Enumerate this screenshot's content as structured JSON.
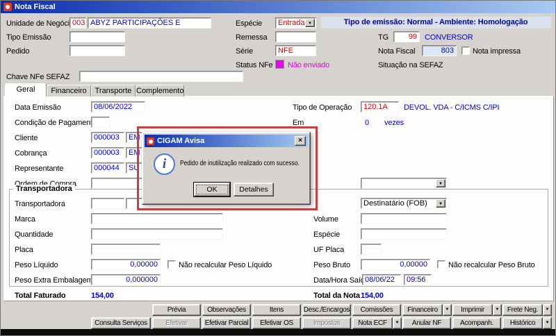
{
  "icons": {
    "dropdown": "▼",
    "close": "×",
    "info": "i"
  },
  "colors": {
    "value_blue": "#0000cc",
    "code_red": "#d40000",
    "status_magenta": "#e000e0",
    "banner_navy": "#0000a0",
    "annotation_red": "#c54141",
    "nota_fiscal_field_bg": "#dbe7f5"
  },
  "window": {
    "title": "Nota Fiscal",
    "banner": "Tipo de emissão: Normal - Ambiente: Homologação"
  },
  "header": {
    "unidade_label": "Unidade de Negócio",
    "unidade_code": "003",
    "unidade_name": "ABYZ PARTICIPAÇÕES E",
    "especie_label": "Espécie",
    "especie_value": "Entrada",
    "tipo_emissao_label": "Tipo Emissão",
    "tipo_emissao_value": "",
    "remessa_label": "Remessa",
    "remessa_value": "",
    "tg_label": "TG",
    "tg_code": "99",
    "tg_name": "CONVERSOR",
    "pedido_label": "Pedido",
    "pedido_value": "",
    "serie_label": "Série",
    "serie_value": "NFE",
    "nota_fiscal_label": "Nota Fiscal",
    "nota_fiscal_value": "803",
    "nota_impressa_label": "Nota impressa",
    "nota_impressa_checked": false,
    "status_nfe_label": "Status NFe",
    "status_nfe_value": "Não enviado",
    "situacao_sefaz_label": "Situação na SEFAZ",
    "chave_label": "Chave NFe SEFAZ",
    "chave_value": ""
  },
  "tabs": [
    {
      "label": "Geral",
      "active": true
    },
    {
      "label": "Financeiro",
      "active": false
    },
    {
      "label": "Transporte",
      "active": false
    },
    {
      "label": "Complemento",
      "active": false
    }
  ],
  "geral": {
    "data_emissao_label": "Data Emissão",
    "data_emissao_value": "08/06/2022",
    "tipo_operacao_label": "Tipo de Operação",
    "tipo_operacao_code": "120.1A",
    "tipo_operacao_desc": "DEVOL. VDA - C/ICMS C/IPI",
    "condicao_label": "Condição de Pagamento",
    "condicao_value": "",
    "em_label": "Em",
    "em_value": "0",
    "vezes_label": "vezes",
    "cliente_label": "Cliente",
    "cliente_code": "000003",
    "cliente_name": "EM",
    "cobranca_label": "Cobrança",
    "cobranca_code": "000003",
    "cobranca_name": "EM",
    "representante_label": "Representante",
    "representante_code": "000044",
    "representante_name": "SU",
    "ordem_label": "Ordem de Compra",
    "ordem_value": "",
    "combo_direita_value": "",
    "frete_value": "Destinatário (FOB)",
    "grupo_transportadora": "Transportadora",
    "transportadora_label": "Transportadora",
    "transportadora_code": "",
    "transportadora_name": "",
    "marca_label": "Marca",
    "marca_value": "",
    "volume_label": "Volume",
    "volume_value": "",
    "quantidade_label": "Quantidade",
    "quantidade_value": "",
    "especie_label": "Espécie",
    "especie_value": "",
    "placa_label": "Placa",
    "placa_value": "",
    "uf_placa_label": "UF Placa",
    "uf_placa_value": "",
    "peso_liquido_label": "Peso Líquido",
    "peso_liquido_value": "0,00000",
    "nao_recalcular_liquido_label": "Não recalcular Peso Líquido",
    "nao_recalcular_liquido_checked": false,
    "peso_bruto_label": "Peso Bruto",
    "peso_bruto_value": "0,00000",
    "nao_recalcular_bruto_label": "Não recalcular Peso Bruto",
    "nao_recalcular_bruto_checked": false,
    "peso_extra_label": "Peso Extra Embalagem",
    "peso_extra_value": "0,000000",
    "data_saida_label": "Data/Hora Saída",
    "data_saida_value": "08/06/22",
    "hora_saida_value": "09:56",
    "total_faturado_label": "Total Faturado",
    "total_faturado_value": "154,00",
    "total_nota_label": "Total da Nota",
    "total_nota_value": "154,00"
  },
  "dialog": {
    "title": "CIGAM Avisa",
    "message": "Pedido de inutilização realizado com sucesso.",
    "ok_label": "OK",
    "detalhes_label": "Detalhes"
  },
  "buttons_row1": [
    "Prévia",
    "Observações",
    "Itens",
    "Desc./Encargos",
    "Comissões",
    "Financeiro",
    "Imprimir",
    "Frete Neg."
  ],
  "buttons_row2": [
    "Consulta Serviços",
    "Efetivar",
    "Efetivar Parcial",
    "Efetivar OS",
    "Impostos",
    "Nota ECF",
    "Anular NF",
    "Acompanh.",
    "Histórico"
  ]
}
